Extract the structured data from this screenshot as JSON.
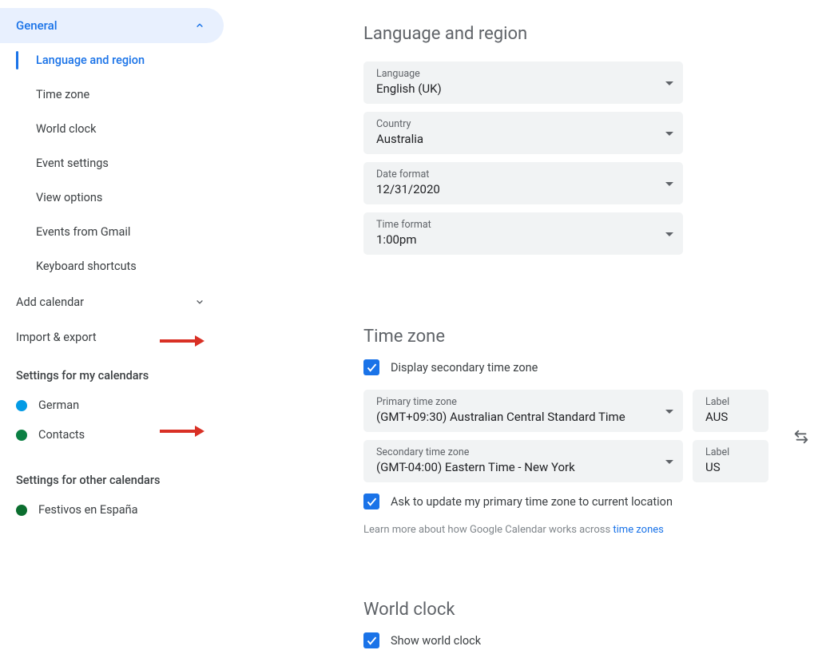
{
  "sidebar": {
    "general": {
      "label": "General",
      "items": [
        {
          "label": "Language and region"
        },
        {
          "label": "Time zone"
        },
        {
          "label": "World clock"
        },
        {
          "label": "Event settings"
        },
        {
          "label": "View options"
        },
        {
          "label": "Events from Gmail"
        },
        {
          "label": "Keyboard shortcuts"
        }
      ]
    },
    "add_calendar": "Add calendar",
    "import_export": "Import & export",
    "my_calendars_heading": "Settings for my calendars",
    "my_calendars": [
      {
        "label": "German",
        "color": "#039be5"
      },
      {
        "label": "Contacts",
        "color": "#0b8043"
      }
    ],
    "other_calendars_heading": "Settings for other calendars",
    "other_calendars": [
      {
        "label": "Festivos en España",
        "color": "#0b6e2f"
      }
    ]
  },
  "lang_region": {
    "title": "Language and region",
    "language": {
      "label": "Language",
      "value": "English (UK)"
    },
    "country": {
      "label": "Country",
      "value": "Australia"
    },
    "date_format": {
      "label": "Date format",
      "value": "12/31/2020"
    },
    "time_format": {
      "label": "Time format",
      "value": "1:00pm"
    }
  },
  "time_zone": {
    "title": "Time zone",
    "display_secondary": "Display secondary time zone",
    "primary": {
      "label": "Primary time zone",
      "value": "(GMT+09:30) Australian Central Standard Time"
    },
    "primary_label": {
      "label": "Label",
      "value": "AUS"
    },
    "secondary": {
      "label": "Secondary time zone",
      "value": "(GMT-04:00) Eastern Time - New York"
    },
    "secondary_label": {
      "label": "Label",
      "value": "US"
    },
    "ask_update": "Ask to update my primary time zone to current location",
    "learn_more_prefix": "Learn more about how Google Calendar works across ",
    "learn_more_link": "time zones"
  },
  "world_clock": {
    "title": "World clock",
    "show": "Show world clock"
  }
}
